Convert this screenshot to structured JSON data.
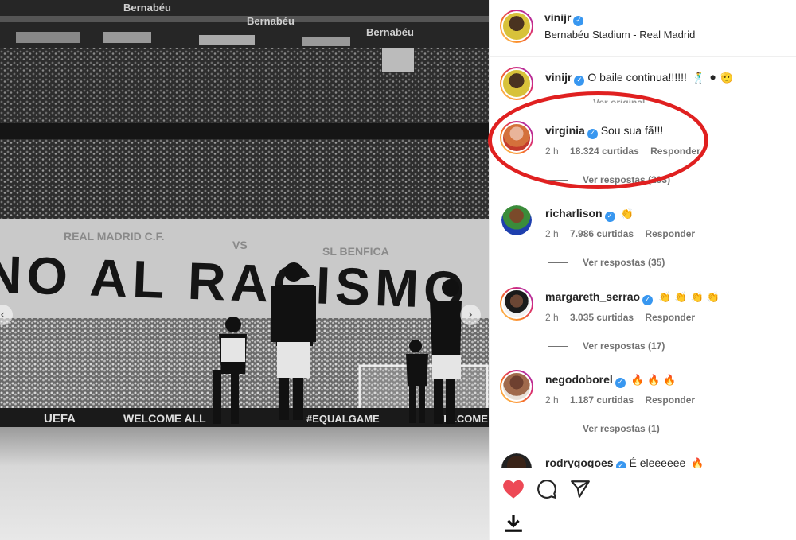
{
  "post": {
    "author": "vinijr",
    "location": "Bernabéu Stadium - Real Madrid"
  },
  "photo": {
    "stadium_text_1": "Bernabéu",
    "stadium_text_2": "Bernabéu",
    "stadium_text_3": "Bernabéu",
    "banner_top_left": "REAL MADRID C.F.",
    "banner_top_mid": "VS",
    "banner_top_right": "SL BENFICA",
    "banner_main": "NO AL RACISMO",
    "board_uefa": "UEFA",
    "board_welcome": "WELCOME ALL",
    "board_hashtag": "#EQUALGAME",
    "board_right": "WELCOME"
  },
  "comments": [
    {
      "username": "vinijr",
      "text": "O baile continua!!!!!!",
      "emojis": "🕺 ⚫ 🫡",
      "partial": "Ver original"
    },
    {
      "username": "virginia",
      "text": "Sou sua fã!!!",
      "time": "2 h",
      "likes": "18.324 curtidas",
      "reply": "Responder",
      "replies": "Ver respostas (293)"
    },
    {
      "username": "richarlison",
      "text": "",
      "emojis": "👏",
      "time": "2 h",
      "likes": "7.986 curtidas",
      "reply": "Responder",
      "replies": "Ver respostas (35)"
    },
    {
      "username": "margareth_serrao",
      "text": "",
      "emojis": "👏 👏 👏 👏",
      "time": "2 h",
      "likes": "3.035 curtidas",
      "reply": "Responder",
      "replies": "Ver respostas (17)"
    },
    {
      "username": "negodoborel",
      "text": "",
      "emojis": "🔥 🔥 🔥",
      "time": "2 h",
      "likes": "1.187 curtidas",
      "reply": "Responder",
      "replies": "Ver respostas (1)"
    },
    {
      "username": "rodrygogoes",
      "text": "É eleeeeee",
      "emojis": "🔥"
    }
  ],
  "actions": {
    "like_icon": "heart-filled-icon",
    "comment_icon": "comment-icon",
    "share_icon": "paper-plane-icon",
    "download_icon": "download-icon",
    "like_color": "#ed4956"
  },
  "colors": {
    "verified": "#3897f0",
    "annotation_circle": "#e02020"
  }
}
